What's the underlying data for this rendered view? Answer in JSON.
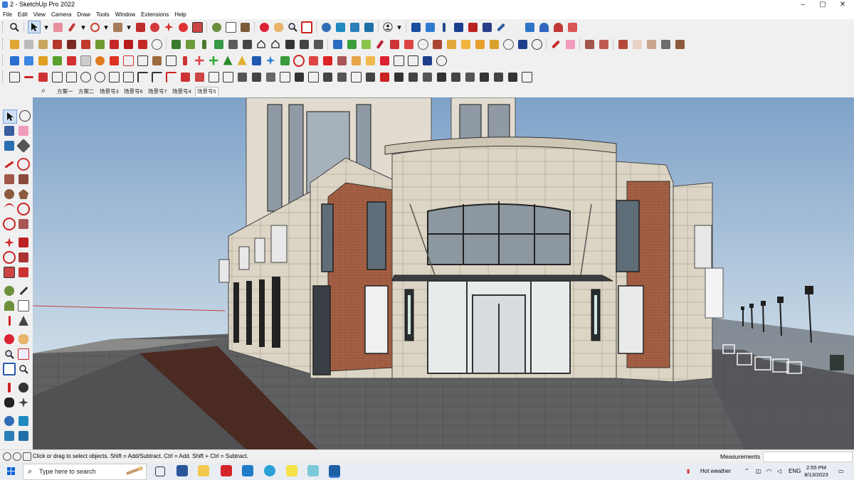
{
  "window": {
    "title": "2 - SketchUp Pro 2022",
    "controls": [
      "–",
      "▢",
      "✕"
    ]
  },
  "menu": [
    "File",
    "Edit",
    "View",
    "Camera",
    "Draw",
    "Tools",
    "Window",
    "Extensions",
    "Help"
  ],
  "scenes": {
    "tabs": [
      "方案一",
      "方案二",
      "场景号3",
      "场景号6",
      "场景号7",
      "场景号4",
      "场景号5"
    ],
    "active": "场景号5"
  },
  "status": {
    "message": "Click or drag to select objects. Shift = Add/Subtract. Ctrl = Add. Shift + Ctrl = Subtract.",
    "measurements_label": "Measurements",
    "measurements_value": ""
  },
  "taskbar": {
    "search_placeholder": "Type here to search",
    "weather": "Hot weather",
    "language": "ENG",
    "time": "2:55 PM",
    "date": "8/13/2023"
  },
  "colors": {
    "sky_top": "#7fa3c9",
    "sky_bottom": "#d9e5ee",
    "brick": "#9e5a3e",
    "stone": "#d9d2c2",
    "pavement": "#5a5c5e"
  }
}
